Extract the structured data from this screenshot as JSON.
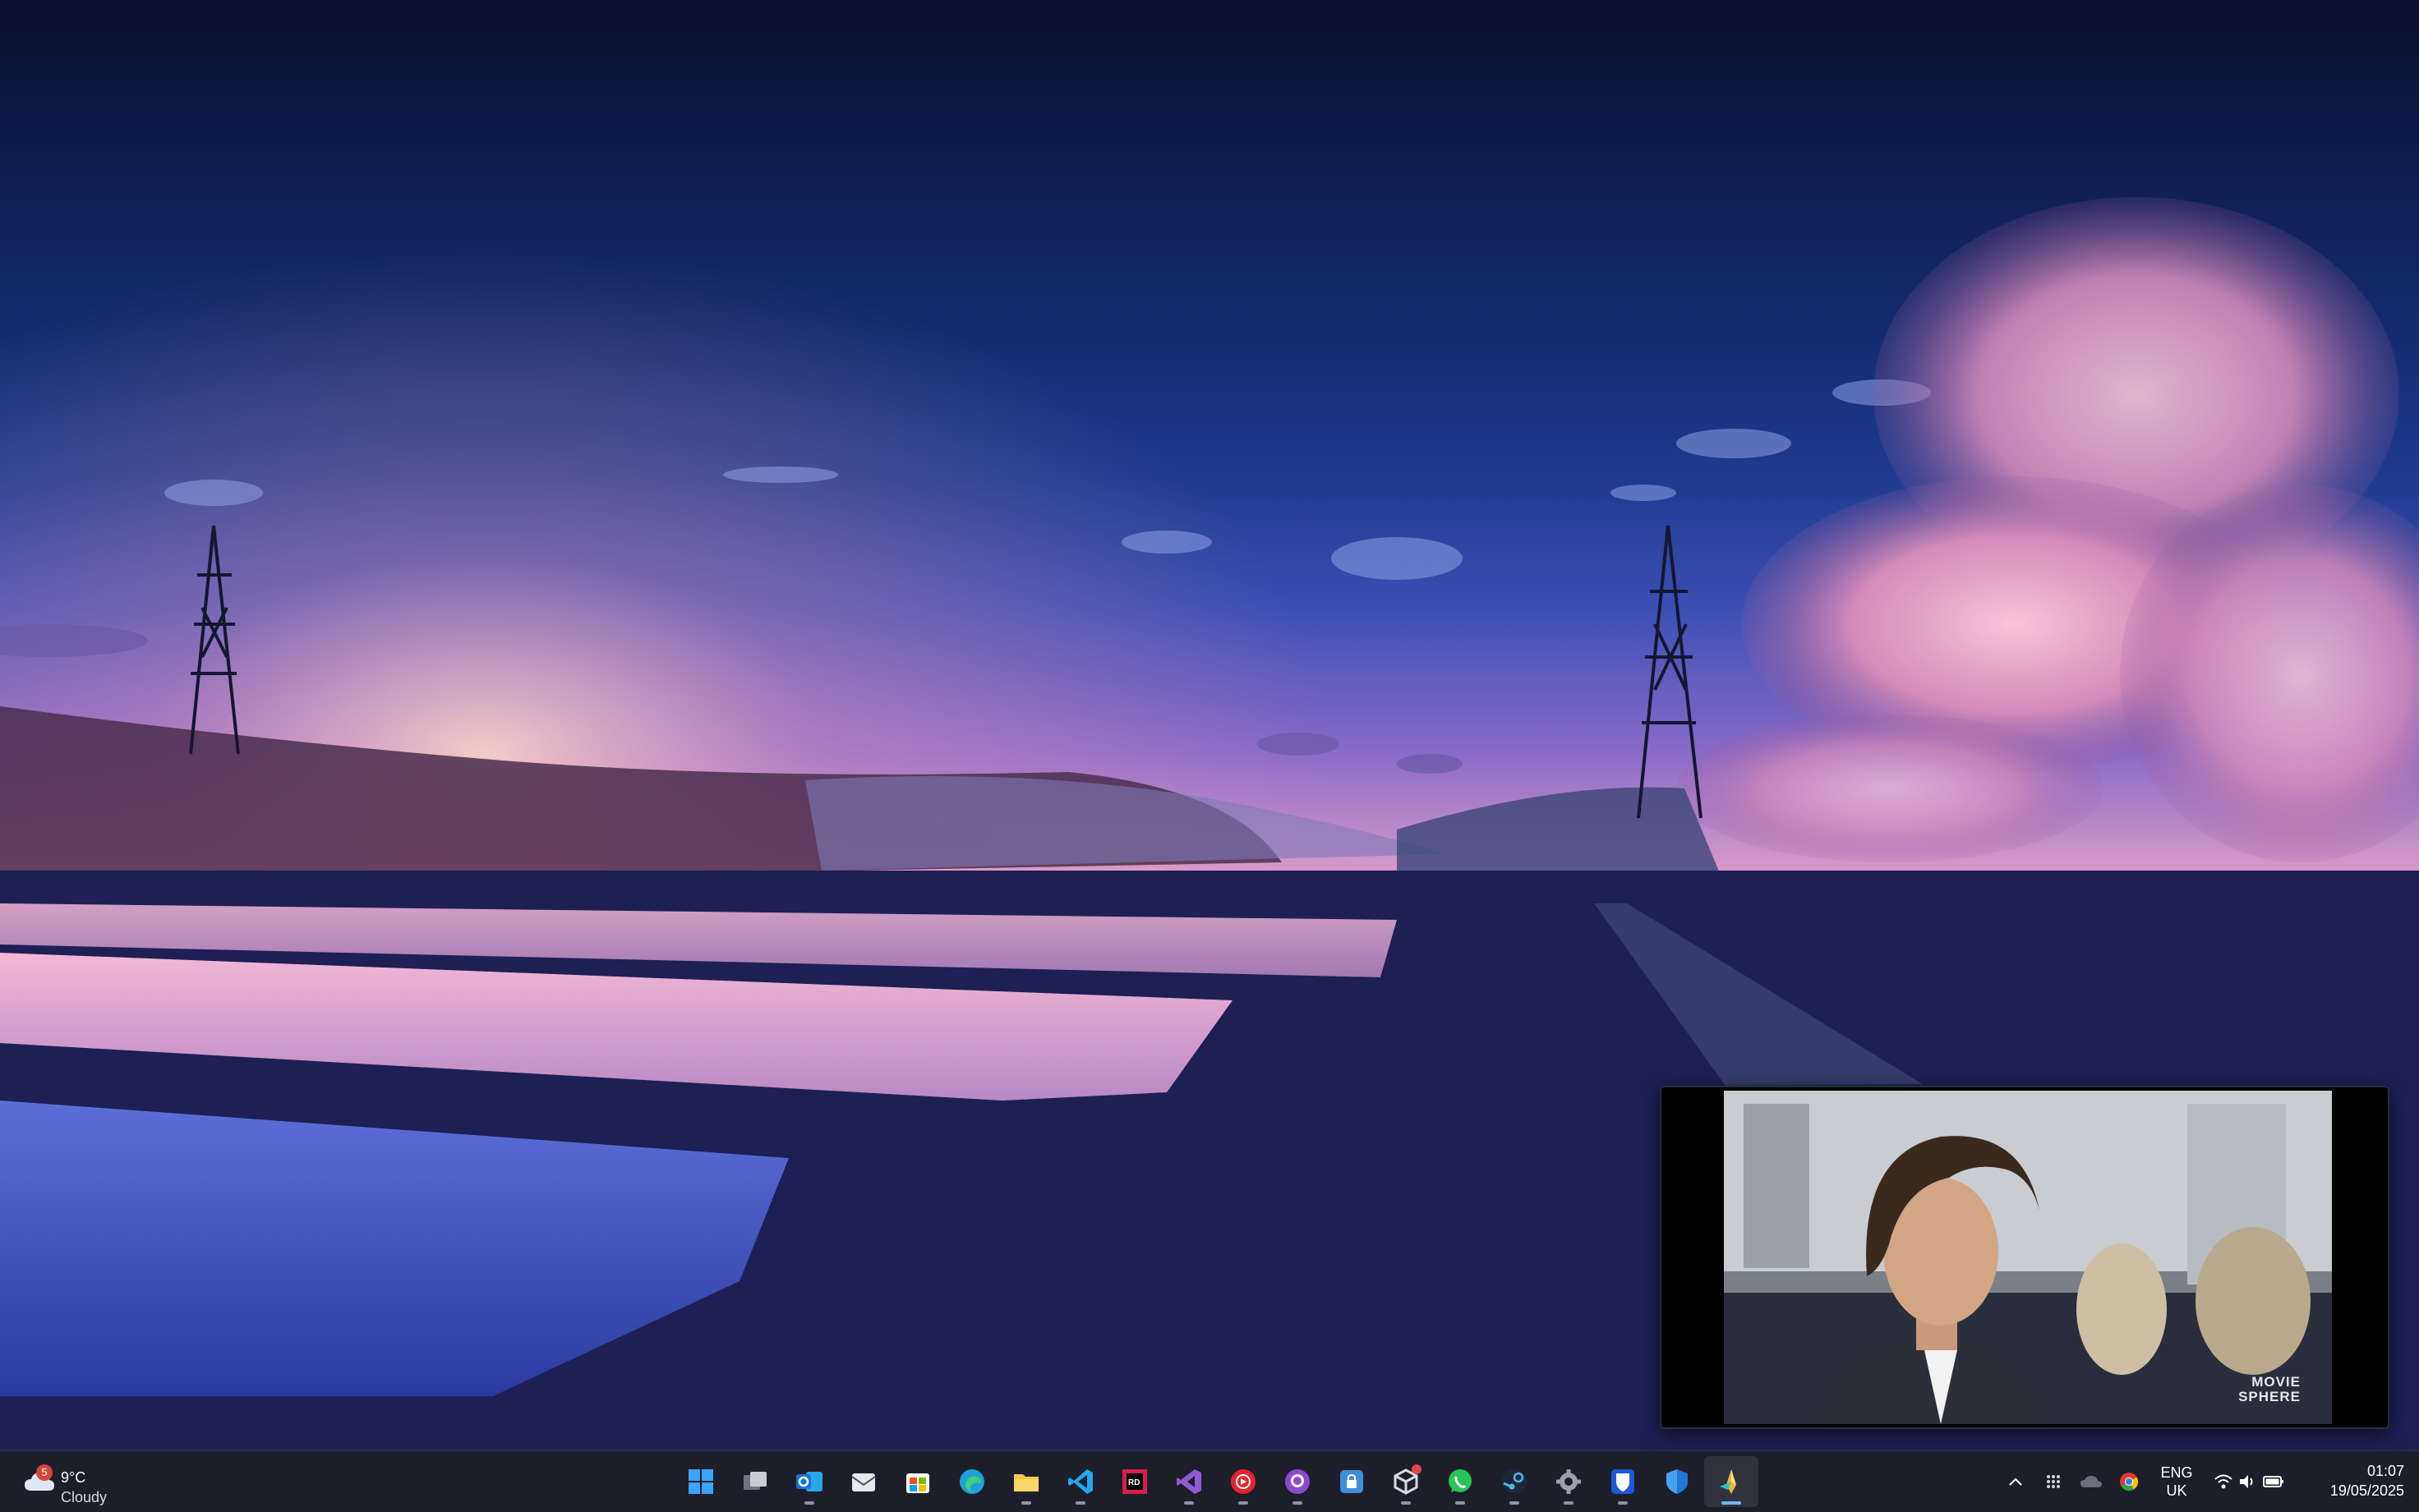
{
  "weather": {
    "badge": "5",
    "temperature": "9°C",
    "condition": "Cloudy",
    "icon": "cloud-icon"
  },
  "pinned_apps": [
    {
      "name": "start",
      "icon": "windows-start-icon",
      "color": "#3ea2ff",
      "running": false
    },
    {
      "name": "task-view",
      "icon": "task-view-icon",
      "color": "#c8ccd6",
      "running": false
    },
    {
      "name": "outlook",
      "icon": "outlook-icon",
      "color": "#1a73d6",
      "running": true
    },
    {
      "name": "mail",
      "icon": "mail-icon",
      "color": "#e8e8e8",
      "running": false
    },
    {
      "name": "microsoft-store",
      "icon": "store-icon",
      "color": "#f2c200",
      "running": false
    },
    {
      "name": "edge",
      "icon": "edge-icon",
      "color": "#1fa0d8",
      "running": false
    },
    {
      "name": "file-explorer",
      "icon": "folder-icon",
      "color": "#f4c94a",
      "running": true
    },
    {
      "name": "vscode",
      "icon": "vscode-icon",
      "color": "#23a7f2",
      "running": true
    },
    {
      "name": "rider",
      "icon": "rider-icon",
      "color": "#d81f4f",
      "running": false
    },
    {
      "name": "visual-studio",
      "icon": "visual-studio-icon",
      "color": "#8f5ad6",
      "running": true
    },
    {
      "name": "youtube-music",
      "icon": "youtube-music-icon",
      "color": "#e3232e",
      "running": true
    },
    {
      "name": "github-desktop",
      "icon": "github-icon",
      "color": "#8a4bd1",
      "running": true
    },
    {
      "name": "password-app",
      "icon": "lock-app-icon",
      "color": "#3d8fd9",
      "running": false
    },
    {
      "name": "unity-hub",
      "icon": "unity-icon",
      "color": "#d7dae2",
      "running": true,
      "notification": true
    },
    {
      "name": "whatsapp",
      "icon": "whatsapp-icon",
      "color": "#28c455",
      "running": true
    },
    {
      "name": "steam",
      "icon": "steam-icon",
      "color": "#5ab3e6",
      "running": true
    },
    {
      "name": "settings",
      "icon": "gear-icon",
      "color": "#9aa0ad",
      "running": true
    },
    {
      "name": "bitwarden",
      "icon": "bitwarden-icon",
      "color": "#1d59d8",
      "running": true
    },
    {
      "name": "windows-security",
      "icon": "shield-icon",
      "color": "#1e78d4",
      "running": false
    },
    {
      "name": "video-player",
      "icon": "player-icon",
      "color": "#f2b43a",
      "running": true,
      "active": true
    }
  ],
  "tray": {
    "overflow_icon": "chevron-up-icon",
    "icons": [
      "grid-icon",
      "onedrive-icon",
      "chrome-icon"
    ],
    "language_line1": "ENG",
    "language_line2": "UK",
    "system_icons": [
      "wifi-icon",
      "volume-icon",
      "battery-icon"
    ]
  },
  "clock": {
    "time": "01:07",
    "date": "19/05/2025"
  },
  "video": {
    "logo_line1": "MOVIE",
    "logo_line2": "SPHERE"
  }
}
